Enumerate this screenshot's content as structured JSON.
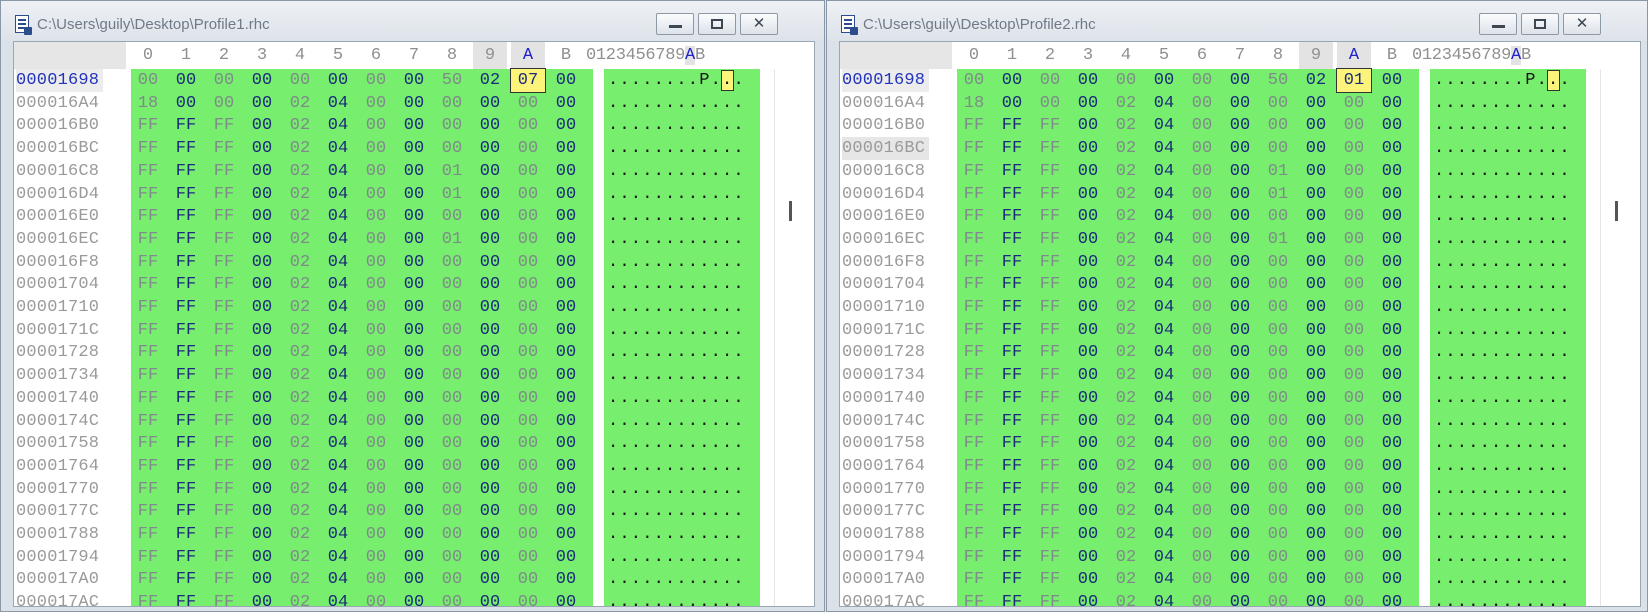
{
  "windows": [
    {
      "title": "C:\\Users\\guily\\Desktop\\Profile1.rhc",
      "selected_value": "07",
      "ascii_first_row": "........P..",
      "ascii_highlight": "."
    },
    {
      "title": "C:\\Users\\guily\\Desktop\\Profile2.rhc",
      "selected_value": "01",
      "ascii_first_row": "........P..",
      "ascii_highlight": "."
    }
  ],
  "columns": [
    "0",
    "1",
    "2",
    "3",
    "4",
    "5",
    "6",
    "7",
    "8",
    "9",
    "A",
    "B"
  ],
  "ascii_header": "0123456789AB",
  "window_buttons": {
    "minimize": "minimize",
    "maximize": "maximize",
    "close": "close"
  },
  "rows": [
    {
      "offset": "00001698",
      "bytes": [
        "00",
        "00",
        "00",
        "00",
        "00",
        "00",
        "00",
        "00",
        "50",
        "02",
        "SEL",
        "00"
      ],
      "ascii": "........P.."
    },
    {
      "offset": "000016A4",
      "bytes": [
        "18",
        "00",
        "00",
        "00",
        "02",
        "04",
        "00",
        "00",
        "00",
        "00",
        "00",
        "00"
      ],
      "ascii": "............"
    },
    {
      "offset": "000016B0",
      "bytes": [
        "FF",
        "FF",
        "FF",
        "00",
        "02",
        "04",
        "00",
        "00",
        "00",
        "00",
        "00",
        "00"
      ],
      "ascii": "............"
    },
    {
      "offset": "000016BC",
      "bytes": [
        "FF",
        "FF",
        "FF",
        "00",
        "02",
        "04",
        "00",
        "00",
        "00",
        "00",
        "00",
        "00"
      ],
      "ascii": "............"
    },
    {
      "offset": "000016C8",
      "bytes": [
        "FF",
        "FF",
        "FF",
        "00",
        "02",
        "04",
        "00",
        "00",
        "01",
        "00",
        "00",
        "00"
      ],
      "ascii": "............"
    },
    {
      "offset": "000016D4",
      "bytes": [
        "FF",
        "FF",
        "FF",
        "00",
        "02",
        "04",
        "00",
        "00",
        "01",
        "00",
        "00",
        "00"
      ],
      "ascii": "............"
    },
    {
      "offset": "000016E0",
      "bytes": [
        "FF",
        "FF",
        "FF",
        "00",
        "02",
        "04",
        "00",
        "00",
        "00",
        "00",
        "00",
        "00"
      ],
      "ascii": "............"
    },
    {
      "offset": "000016EC",
      "bytes": [
        "FF",
        "FF",
        "FF",
        "00",
        "02",
        "04",
        "00",
        "00",
        "01",
        "00",
        "00",
        "00"
      ],
      "ascii": "............"
    },
    {
      "offset": "000016F8",
      "bytes": [
        "FF",
        "FF",
        "FF",
        "00",
        "02",
        "04",
        "00",
        "00",
        "00",
        "00",
        "00",
        "00"
      ],
      "ascii": "............"
    },
    {
      "offset": "00001704",
      "bytes": [
        "FF",
        "FF",
        "FF",
        "00",
        "02",
        "04",
        "00",
        "00",
        "00",
        "00",
        "00",
        "00"
      ],
      "ascii": "............"
    },
    {
      "offset": "00001710",
      "bytes": [
        "FF",
        "FF",
        "FF",
        "00",
        "02",
        "04",
        "00",
        "00",
        "00",
        "00",
        "00",
        "00"
      ],
      "ascii": "............"
    },
    {
      "offset": "0000171C",
      "bytes": [
        "FF",
        "FF",
        "FF",
        "00",
        "02",
        "04",
        "00",
        "00",
        "00",
        "00",
        "00",
        "00"
      ],
      "ascii": "............"
    },
    {
      "offset": "00001728",
      "bytes": [
        "FF",
        "FF",
        "FF",
        "00",
        "02",
        "04",
        "00",
        "00",
        "00",
        "00",
        "00",
        "00"
      ],
      "ascii": "............"
    },
    {
      "offset": "00001734",
      "bytes": [
        "FF",
        "FF",
        "FF",
        "00",
        "02",
        "04",
        "00",
        "00",
        "00",
        "00",
        "00",
        "00"
      ],
      "ascii": "............"
    },
    {
      "offset": "00001740",
      "bytes": [
        "FF",
        "FF",
        "FF",
        "00",
        "02",
        "04",
        "00",
        "00",
        "00",
        "00",
        "00",
        "00"
      ],
      "ascii": "............"
    },
    {
      "offset": "0000174C",
      "bytes": [
        "FF",
        "FF",
        "FF",
        "00",
        "02",
        "04",
        "00",
        "00",
        "00",
        "00",
        "00",
        "00"
      ],
      "ascii": "............"
    },
    {
      "offset": "00001758",
      "bytes": [
        "FF",
        "FF",
        "FF",
        "00",
        "02",
        "04",
        "00",
        "00",
        "00",
        "00",
        "00",
        "00"
      ],
      "ascii": "............"
    },
    {
      "offset": "00001764",
      "bytes": [
        "FF",
        "FF",
        "FF",
        "00",
        "02",
        "04",
        "00",
        "00",
        "00",
        "00",
        "00",
        "00"
      ],
      "ascii": "............"
    },
    {
      "offset": "00001770",
      "bytes": [
        "FF",
        "FF",
        "FF",
        "00",
        "02",
        "04",
        "00",
        "00",
        "00",
        "00",
        "00",
        "00"
      ],
      "ascii": "............"
    },
    {
      "offset": "0000177C",
      "bytes": [
        "FF",
        "FF",
        "FF",
        "00",
        "02",
        "04",
        "00",
        "00",
        "00",
        "00",
        "00",
        "00"
      ],
      "ascii": "............"
    },
    {
      "offset": "00001788",
      "bytes": [
        "FF",
        "FF",
        "FF",
        "00",
        "02",
        "04",
        "00",
        "00",
        "00",
        "00",
        "00",
        "00"
      ],
      "ascii": "............"
    },
    {
      "offset": "00001794",
      "bytes": [
        "FF",
        "FF",
        "FF",
        "00",
        "02",
        "04",
        "00",
        "00",
        "00",
        "00",
        "00",
        "00"
      ],
      "ascii": "............"
    },
    {
      "offset": "000017A0",
      "bytes": [
        "FF",
        "FF",
        "FF",
        "00",
        "02",
        "04",
        "00",
        "00",
        "00",
        "00",
        "00",
        "00"
      ],
      "ascii": "............"
    },
    {
      "offset": "000017AC",
      "bytes": [
        "FF",
        "FF",
        "FF",
        "00",
        "02",
        "04",
        "00",
        "00",
        "00",
        "00",
        "00",
        "00"
      ],
      "ascii": "............"
    }
  ],
  "colors": {
    "data_bg": "#77ee6e",
    "selection": "#fbf37a",
    "dark_byte": "#1b2a7a",
    "light_byte": "#7f8a8a",
    "cursor_offset": "#2233bb"
  }
}
